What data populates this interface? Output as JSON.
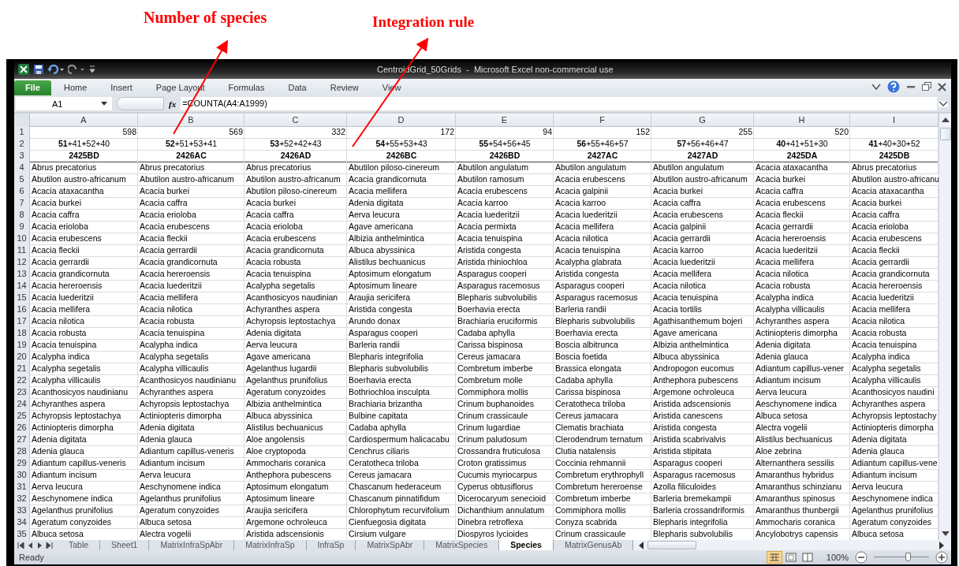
{
  "annotations": [
    {
      "text": "Number of species"
    },
    {
      "text": "Integration rule"
    }
  ],
  "window": {
    "title": "CentroidGrid_50Grids  -  Microsoft Excel non-commercial use"
  },
  "ribbon_tabs": [
    {
      "label": "File",
      "selected": true
    },
    {
      "label": "Home",
      "selected": false
    },
    {
      "label": "Insert",
      "selected": false
    },
    {
      "label": "Page Layout",
      "selected": false
    },
    {
      "label": "Formulas",
      "selected": false
    },
    {
      "label": "Data",
      "selected": false
    },
    {
      "label": "Review",
      "selected": false
    },
    {
      "label": "View",
      "selected": false
    }
  ],
  "formula_bar": {
    "name_box": "A1",
    "function_button": "fx",
    "formula": "=COUNTA(A4:A1999)"
  },
  "sheet": {
    "columns": [
      "A",
      "B",
      "C",
      "D",
      "E",
      "F",
      "G",
      "H",
      "I"
    ],
    "rows": [
      {
        "number": "1",
        "kind": "count",
        "cells": [
          "598",
          "569",
          "332",
          "172",
          "94",
          "152",
          "255",
          "520",
          null
        ]
      },
      {
        "number": "2",
        "kind": "rule",
        "cells": [
          "**51**+41+52+40",
          "**52**+51+53+41",
          "**53**+52+42+43",
          "**54**+55+53+43",
          "**55**+54+56+45",
          "**56**+55+46+57",
          "**57**+56+46+47",
          "**40**+41+51+30",
          "**41**+40+30+52"
        ]
      },
      {
        "number": "3",
        "kind": "code",
        "cells": [
          "2425BD",
          "2426AC",
          "2426AD",
          "2426BC",
          "2426BD",
          "2427AC",
          "2427AD",
          "2425DA",
          "2425DB"
        ]
      },
      {
        "number": "4",
        "kind": "species",
        "cells": [
          "Abrus precatorius",
          "Abrus precatorius",
          "Abrus precatorius",
          "Abutilon piloso-cinereum",
          "Abutilon angulatum",
          "Abutilon angulatum",
          "Abutilon angulatum",
          "Acacia ataxacantha",
          "Abrus precatorius"
        ]
      },
      {
        "number": "5",
        "kind": "species",
        "cells": [
          "Abutilon austro-africanum",
          "Abutilon austro-africanum",
          "Abutilon austro-africanum",
          "Acacia grandicornuta",
          "Abutilon ramosum",
          "Acacia erubescens",
          "Abutilon austro-africanum",
          "Acacia burkei",
          "Abutilon austro-africanu"
        ]
      },
      {
        "number": "6",
        "kind": "species",
        "cells": [
          "Acacia ataxacantha",
          "Acacia burkei",
          "Abutilon piloso-cinereum",
          "Acacia mellifera",
          "Acacia erubescens",
          "Acacia galpinii",
          "Acacia burkei",
          "Acacia caffra",
          "Acacia ataxacantha"
        ]
      },
      {
        "number": "7",
        "kind": "species",
        "cells": [
          "Acacia burkei",
          "Acacia caffra",
          "Acacia burkei",
          "Adenia digitata",
          "Acacia karroo",
          "Acacia karroo",
          "Acacia caffra",
          "Acacia erubescens",
          "Acacia burkei"
        ]
      },
      {
        "number": "8",
        "kind": "species",
        "cells": [
          "Acacia caffra",
          "Acacia erioloba",
          "Acacia caffra",
          "Aerva leucura",
          "Acacia luederitzii",
          "Acacia luederitzii",
          "Acacia erubescens",
          "Acacia fleckii",
          "Acacia caffra"
        ]
      },
      {
        "number": "9",
        "kind": "species",
        "cells": [
          "Acacia erioloba",
          "Acacia erubescens",
          "Acacia erioloba",
          "Agave americana",
          "Acacia permixta",
          "Acacia mellifera",
          "Acacia galpinii",
          "Acacia gerrardii",
          "Acacia erioloba"
        ]
      },
      {
        "number": "10",
        "kind": "species",
        "cells": [
          "Acacia erubescens",
          "Acacia fleckii",
          "Acacia erubescens",
          "Albizia anthelmintica",
          "Acacia tenuispina",
          "Acacia nilotica",
          "Acacia gerrardii",
          "Acacia hereroensis",
          "Acacia erubescens"
        ]
      },
      {
        "number": "11",
        "kind": "species",
        "cells": [
          "Acacia fleckii",
          "Acacia gerrardii",
          "Acacia grandicornuta",
          "Albuca abyssinica",
          "Aristida congesta",
          "Acacia tenuispina",
          "Acacia karroo",
          "Acacia luederitzii",
          "Acacia fleckii"
        ]
      },
      {
        "number": "12",
        "kind": "species",
        "cells": [
          "Acacia gerrardii",
          "Acacia grandicornuta",
          "Acacia robusta",
          "Alistilus bechuanicus",
          "Aristida rhiniochloa",
          "Acalypha glabrata",
          "Acacia luederitzii",
          "Acacia mellifera",
          "Acacia gerrardii"
        ]
      },
      {
        "number": "13",
        "kind": "species",
        "cells": [
          "Acacia grandicornuta",
          "Acacia hereroensis",
          "Acacia tenuispina",
          "Aptosimum elongatum",
          "Asparagus cooperi",
          "Aristida congesta",
          "Acacia mellifera",
          "Acacia nilotica",
          "Acacia grandicornuta"
        ]
      },
      {
        "number": "14",
        "kind": "species",
        "cells": [
          "Acacia hereroensis",
          "Acacia luederitzii",
          "Acalypha segetalis",
          "Aptosimum lineare",
          "Asparagus racemosus",
          "Asparagus cooperi",
          "Acacia nilotica",
          "Acacia robusta",
          "Acacia hereroensis"
        ]
      },
      {
        "number": "15",
        "kind": "species",
        "cells": [
          "Acacia luederitzii",
          "Acacia mellifera",
          "Acanthosicyos naudinian",
          "Araujia sericifera",
          "Blepharis subvolubilis",
          "Asparagus racemosus",
          "Acacia tenuispina",
          "Acalypha indica",
          "Acacia luederitzii"
        ]
      },
      {
        "number": "16",
        "kind": "species",
        "cells": [
          "Acacia mellifera",
          "Acacia nilotica",
          "Achyranthes aspera",
          "Aristida congesta",
          "Boerhavia erecta",
          "Barleria randii",
          "Acacia tortilis",
          "Acalypha villicaulis",
          "Acacia mellifera"
        ]
      },
      {
        "number": "17",
        "kind": "species",
        "cells": [
          "Acacia nilotica",
          "Acacia robusta",
          "Achyropsis leptostachya",
          "Arundo donax",
          "Brachiaria eruciformis",
          "Blepharis subvolubilis",
          "Agathisanthemum bojeri",
          "Achyranthes aspera",
          "Acacia nilotica"
        ]
      },
      {
        "number": "18",
        "kind": "species",
        "cells": [
          "Acacia robusta",
          "Acacia tenuispina",
          "Adenia digitata",
          "Asparagus cooperi",
          "Cadaba aphylla",
          "Boerhavia erecta",
          "Agave americana",
          "Actiniopteris dimorpha",
          "Acacia robusta"
        ]
      },
      {
        "number": "19",
        "kind": "species",
        "cells": [
          "Acacia tenuispina",
          "Acalypha indica",
          "Aerva leucura",
          "Barleria randii",
          "Carissa bispinosa",
          "Boscia albitrunca",
          "Albizia anthelmintica",
          "Adenia digitata",
          "Acacia tenuispina"
        ]
      },
      {
        "number": "20",
        "kind": "species",
        "cells": [
          "Acalypha indica",
          "Acalypha segetalis",
          "Agave americana",
          "Blepharis integrifolia",
          "Cereus jamacara",
          "Boscia foetida",
          "Albuca abyssinica",
          "Adenia glauca",
          "Acalypha indica"
        ]
      },
      {
        "number": "21",
        "kind": "species",
        "cells": [
          "Acalypha segetalis",
          "Acalypha villicaulis",
          "Agelanthus lugardii",
          "Blepharis subvolubilis",
          "Combretum imberbe",
          "Brassica elongata",
          "Andropogon eucomus",
          "Adiantum capillus-vener",
          "Acalypha segetalis"
        ]
      },
      {
        "number": "22",
        "kind": "species",
        "cells": [
          "Acalypha villicaulis",
          "Acanthosicyos naudinianu",
          "Agelanthus prunifolius",
          "Boerhavia erecta",
          "Combretum molle",
          "Cadaba aphylla",
          "Anthephora pubescens",
          "Adiantum incisum",
          "Acalypha villicaulis"
        ]
      },
      {
        "number": "23",
        "kind": "species",
        "cells": [
          "Acanthosicyos naudinianu",
          "Achyranthes aspera",
          "Ageratum conyzoides",
          "Bothriochloa insculpta",
          "Commiphora mollis",
          "Carissa bispinosa",
          "Argemone ochroleuca",
          "Aerva leucura",
          "Acanthosicyos naudini"
        ]
      },
      {
        "number": "24",
        "kind": "species",
        "cells": [
          "Achyranthes aspera",
          "Achyropsis leptostachya",
          "Albizia anthelmintica",
          "Brachiaria brizantha",
          "Crinum buphanoides",
          "Ceratotheca triloba",
          "Aristida adscensionis",
          "Aeschynomene indica",
          "Achyranthes aspera"
        ]
      },
      {
        "number": "25",
        "kind": "species",
        "cells": [
          "Achyropsis leptostachya",
          "Actiniopteris dimorpha",
          "Albuca abyssinica",
          "Bulbine capitata",
          "Crinum crassicaule",
          "Cereus jamacara",
          "Aristida canescens",
          "Albuca setosa",
          "Achyropsis leptostachy"
        ]
      },
      {
        "number": "26",
        "kind": "species",
        "cells": [
          "Actiniopteris dimorpha",
          "Adenia digitata",
          "Alistilus bechuanicus",
          "Cadaba aphylla",
          "Crinum lugardiae",
          "Clematis brachiata",
          "Aristida congesta",
          "Alectra vogelii",
          "Actiniopteris dimorpha"
        ]
      },
      {
        "number": "27",
        "kind": "species",
        "cells": [
          "Adenia digitata",
          "Adenia glauca",
          "Aloe angolensis",
          "Cardiospermum halicacabu",
          "Crinum paludosum",
          "Clerodendrum ternatum",
          "Aristida scabrivalvis",
          "Alistilus bechuanicus",
          "Adenia digitata"
        ]
      },
      {
        "number": "28",
        "kind": "species",
        "cells": [
          "Adenia glauca",
          "Adiantum capillus-veneris",
          "Aloe cryptopoda",
          "Cenchrus ciliaris",
          "Crossandra fruticulosa",
          "Clutia natalensis",
          "Aristida stipitata",
          "Aloe zebrina",
          "Adenia glauca"
        ]
      },
      {
        "number": "29",
        "kind": "species",
        "cells": [
          "Adiantum capillus-veneris",
          "Adiantum incisum",
          "Ammocharis coranica",
          "Ceratotheca triloba",
          "Croton gratissimus",
          "Coccinia rehmannii",
          "Asparagus cooperi",
          "Alternanthera sessilis",
          "Adiantum capillus-vene"
        ]
      },
      {
        "number": "30",
        "kind": "species",
        "cells": [
          "Adiantum incisum",
          "Aerva leucura",
          "Anthephora pubescens",
          "Cereus jamacara",
          "Cucumis myriocarpus",
          "Combretum erythrophyll",
          "Asparagus racemosus",
          "Amaranthus hybridus",
          "Adiantum incisum"
        ]
      },
      {
        "number": "31",
        "kind": "species",
        "cells": [
          "Aerva leucura",
          "Aeschynomene indica",
          "Aptosimum elongatum",
          "Chascanum hederaceum",
          "Cyperus obtusiflorus",
          "Combretum hereroense",
          "Azolla filiculoides",
          "Amaranthus schinzianu",
          "Aerva leucura"
        ]
      },
      {
        "number": "32",
        "kind": "species",
        "cells": [
          "Aeschynomene indica",
          "Agelanthus prunifolius",
          "Aptosimum lineare",
          "Chascanum pinnatifidum",
          "Dicerocaryum senecioid",
          "Combretum imberbe",
          "Barleria bremekampii",
          "Amaranthus spinosus",
          "Aeschynomene indica"
        ]
      },
      {
        "number": "33",
        "kind": "species",
        "cells": [
          "Agelanthus prunifolius",
          "Ageratum conyzoides",
          "Araujia sericifera",
          "Chlorophytum recurvifolium",
          "Dichanthium annulatum",
          "Commiphora mollis",
          "Barleria crossandriformis",
          "Amaranthus thunbergii",
          "Agelanthus prunifolius"
        ]
      },
      {
        "number": "34",
        "kind": "species",
        "cells": [
          "Ageratum conyzoides",
          "Albuca setosa",
          "Argemone ochroleuca",
          "Cienfuegosia digitata",
          "Dinebra retroflexa",
          "Conyza scabrida",
          "Blepharis integrifolia",
          "Ammocharis coranica",
          "Ageratum conyzoides"
        ]
      },
      {
        "number": "35",
        "kind": "species",
        "cells": [
          "Albuca setosa",
          "Alectra vogelii",
          "Aristida adscensionis",
          "Cirsium vulgare",
          "Diospyros lycioides",
          "Crinum crassicaule",
          "Blepharis subvolubilis",
          "Ancylobotrys capensis",
          "Albuca setosa"
        ]
      }
    ]
  },
  "sheet_tabs": [
    {
      "label": "Table",
      "selected": false
    },
    {
      "label": "Sheet1",
      "selected": false
    },
    {
      "label": "MatrixInfraSpAbr",
      "selected": false
    },
    {
      "label": "MatrixInfraSp",
      "selected": false
    },
    {
      "label": "InfraSp",
      "selected": false
    },
    {
      "label": "MatrixSpAbr",
      "selected": false
    },
    {
      "label": "MatrixSpecies",
      "selected": false
    },
    {
      "label": "Species",
      "selected": true
    },
    {
      "label": "MatrixGenusAb",
      "selected": false
    }
  ],
  "status_bar": {
    "status": "Ready",
    "zoom": "100%",
    "zoom_slider": {
      "level": 0.62
    }
  }
}
